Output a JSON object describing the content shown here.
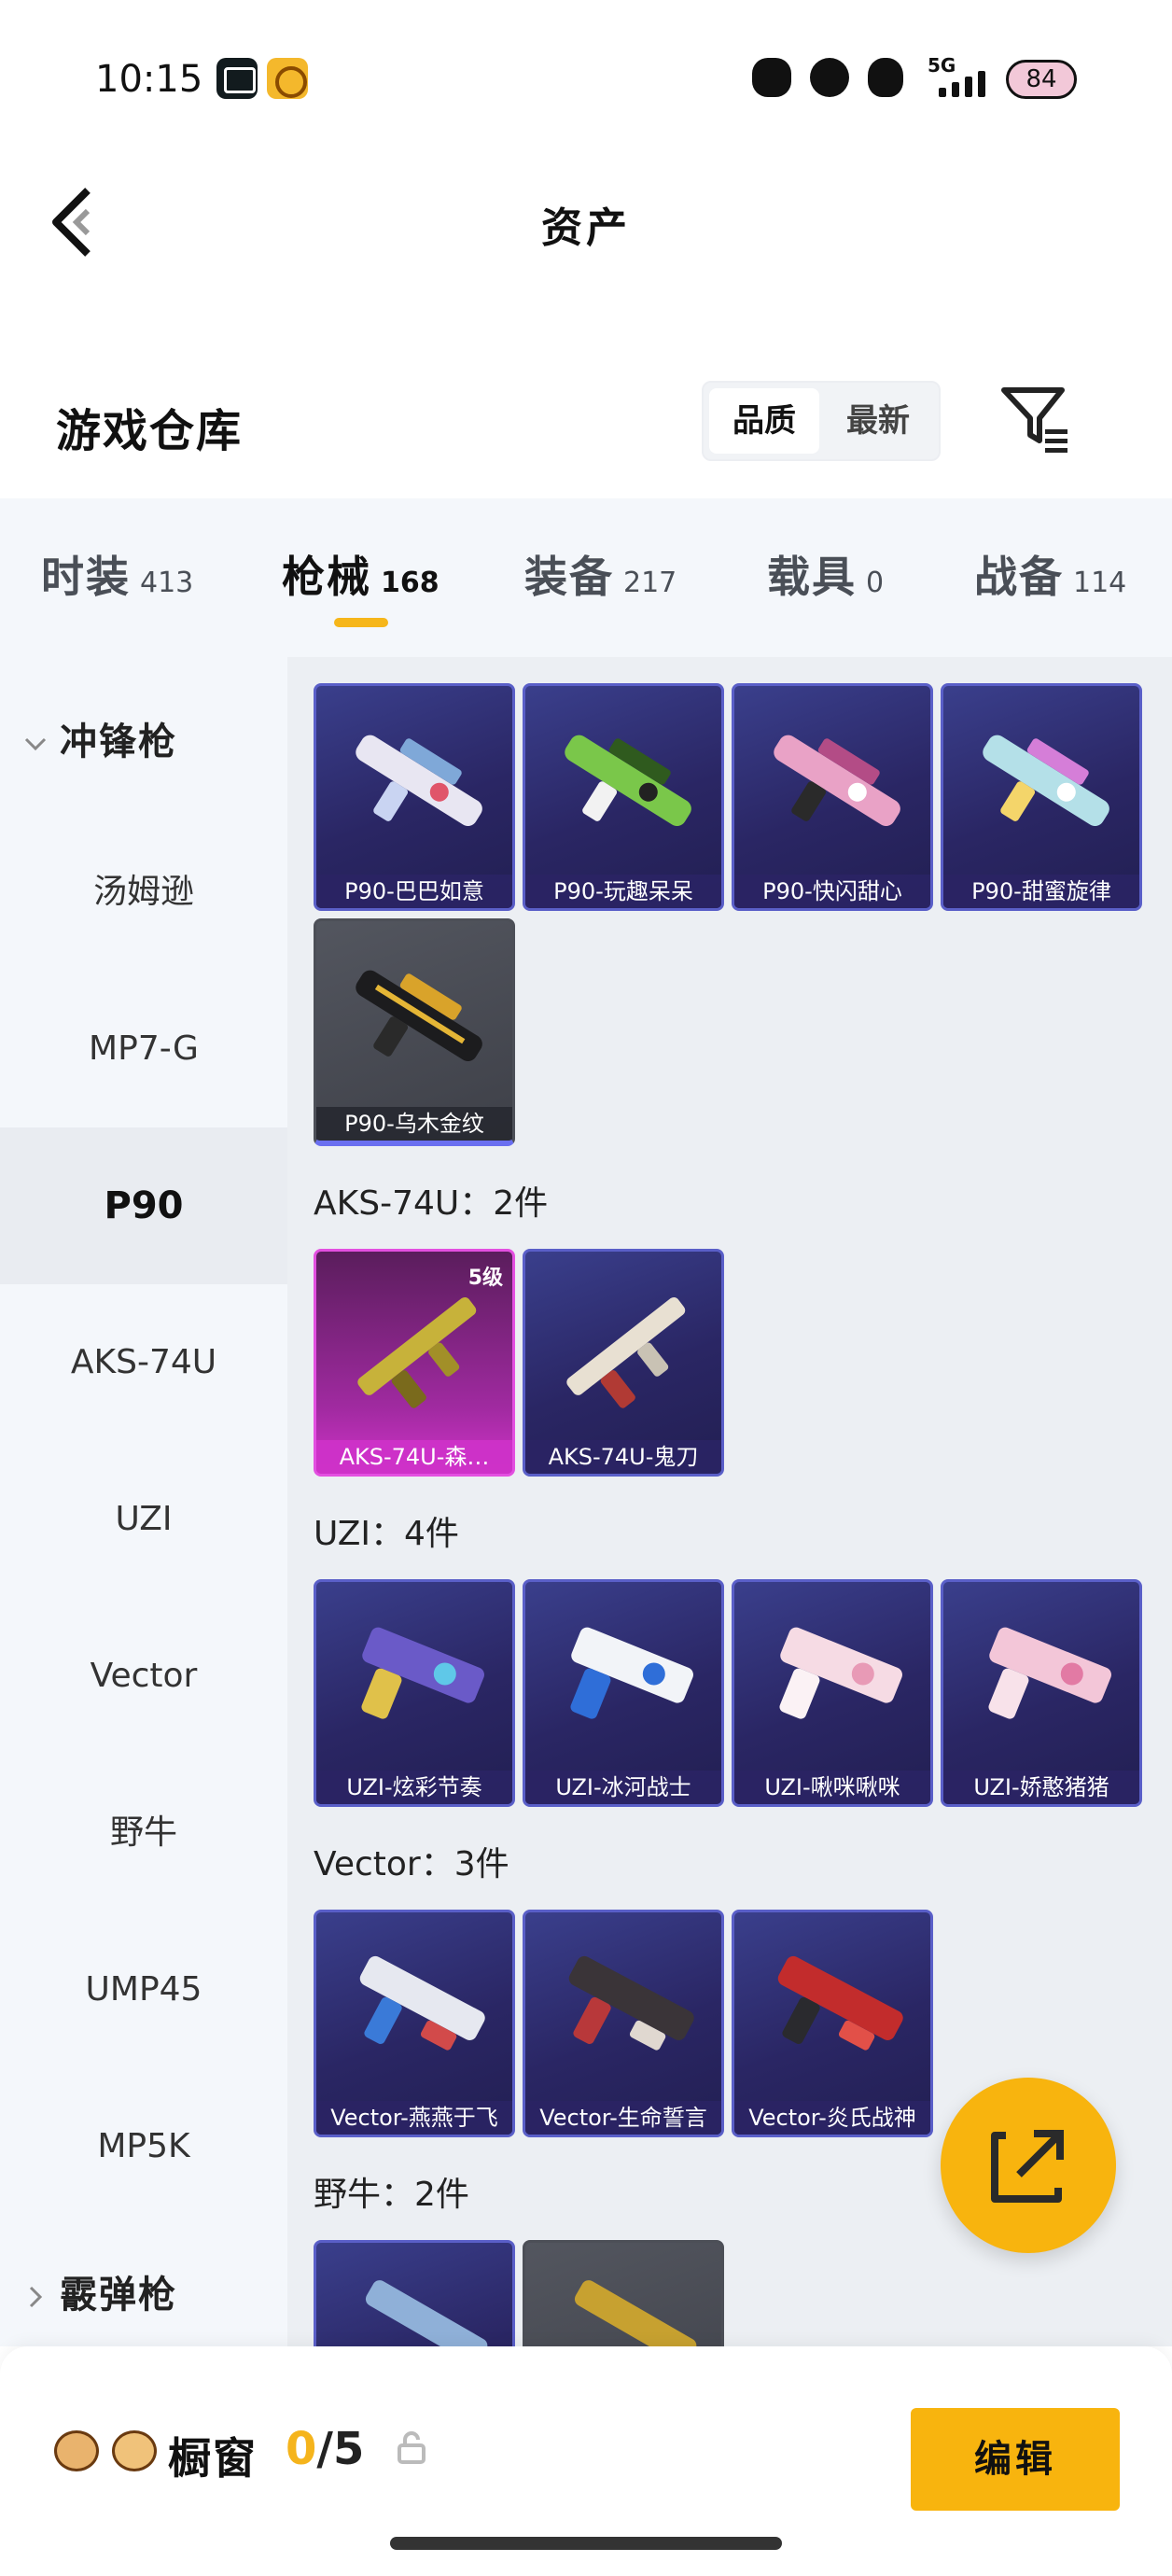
{
  "status_bar": {
    "time": "10:15",
    "network": "5G",
    "battery": "84"
  },
  "header": {
    "title": "资产"
  },
  "warehouse": {
    "title": "游戏仓库",
    "sort_options": [
      "品质",
      "最新"
    ],
    "selected_sort": "品质"
  },
  "tabs": [
    {
      "label": "时装",
      "count": "413"
    },
    {
      "label": "枪械",
      "count": "168"
    },
    {
      "label": "装备",
      "count": "217"
    },
    {
      "label": "载具",
      "count": "0"
    },
    {
      "label": "战备",
      "count": "114"
    }
  ],
  "active_tab": "枪械",
  "sidebar": {
    "group_expanded": "冲锋枪",
    "items": [
      "汤姆逊",
      "MP7-G",
      "P90",
      "AKS-74U",
      "UZI",
      "Vector",
      "野牛",
      "UMP45",
      "MP5K"
    ],
    "active_item": "P90",
    "group_collapsed": "霰弹枪"
  },
  "sections": [
    {
      "title": "",
      "items": [
        {
          "label": "P90-巴巴如意",
          "style": "purple"
        },
        {
          "label": "P90-玩趣呆呆",
          "style": "purple"
        },
        {
          "label": "P90-快闪甜心",
          "style": "purple"
        },
        {
          "label": "P90-甜蜜旋律",
          "style": "purple"
        },
        {
          "label": "P90-乌木金纹",
          "style": "gray"
        }
      ]
    },
    {
      "title": "AKS-74U：2件",
      "items": [
        {
          "label": "AKS-74U-森…",
          "style": "pink",
          "level": "5级"
        },
        {
          "label": "AKS-74U-鬼刀",
          "style": "purple"
        }
      ]
    },
    {
      "title": "UZI：4件",
      "items": [
        {
          "label": "UZI-炫彩节奏",
          "style": "purple"
        },
        {
          "label": "UZI-冰河战士",
          "style": "purple"
        },
        {
          "label": "UZI-啾咪啾咪",
          "style": "purple"
        },
        {
          "label": "UZI-娇憨猪猪",
          "style": "purple"
        }
      ]
    },
    {
      "title": "Vector：3件",
      "items": [
        {
          "label": "Vector-燕燕于飞",
          "style": "purple"
        },
        {
          "label": "Vector-生命誓言",
          "style": "purple"
        },
        {
          "label": "Vector-炎氏战神",
          "style": "purple"
        }
      ]
    },
    {
      "title": "野牛：2件",
      "items": [
        {
          "label": "",
          "style": "purple"
        },
        {
          "label": "",
          "style": "gray"
        }
      ]
    }
  ],
  "bottom_bar": {
    "showcase_label": "橱窗",
    "showcase_current": "0",
    "showcase_total": "/5",
    "edit_label": "编辑"
  },
  "colors": {
    "accent": "#f8b40e",
    "card_purple": "#2a2664",
    "card_pink": "#d033c8",
    "card_gray": "#3e4048"
  }
}
